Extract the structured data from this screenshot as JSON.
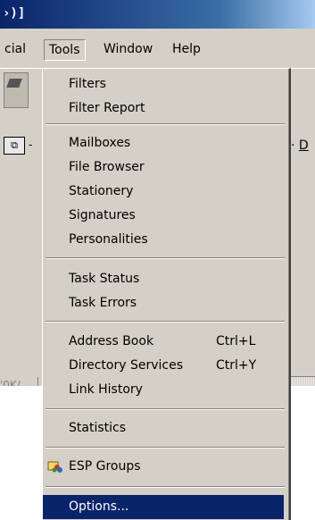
{
  "window": {
    "title_fragment": "›)]"
  },
  "menubar": {
    "items": [
      {
        "label": "cial"
      },
      {
        "label": "Tools"
      },
      {
        "label": "Window"
      },
      {
        "label": "Help"
      }
    ]
  },
  "toolbar": {
    "dash": "-",
    "right_link": "D",
    "status_left": "'0K/"
  },
  "tools_menu": {
    "items": [
      {
        "label": "Filters"
      },
      {
        "label": "Filter Report"
      },
      {
        "label": "Mailboxes"
      },
      {
        "label": "File Browser"
      },
      {
        "label": "Stationery"
      },
      {
        "label": "Signatures"
      },
      {
        "label": "Personalities"
      },
      {
        "label": "Task Status"
      },
      {
        "label": "Task Errors"
      },
      {
        "label": "Address Book",
        "shortcut": "Ctrl+L"
      },
      {
        "label": "Directory Services",
        "shortcut": "Ctrl+Y"
      },
      {
        "label": "Link History"
      },
      {
        "label": "Statistics"
      },
      {
        "label": "ESP Groups",
        "icon": "esp-groups-icon"
      },
      {
        "label": "Options...",
        "highlighted": true
      }
    ]
  },
  "colors": {
    "menu_bg": "#d4d0c8",
    "highlight": "#0a246a",
    "title_start": "#0a246a"
  }
}
